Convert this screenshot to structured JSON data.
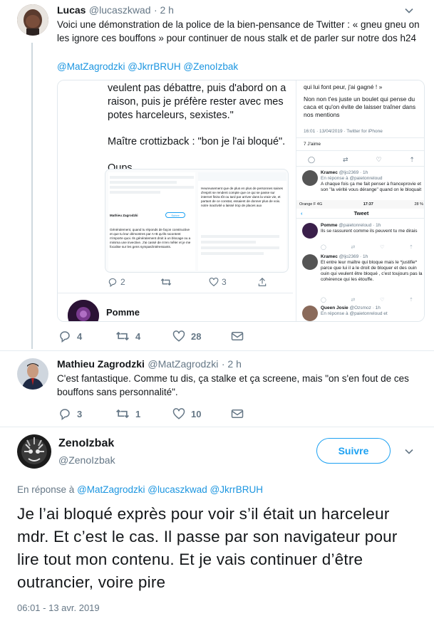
{
  "tweet1": {
    "name": "Lucas",
    "handle": "@lucaszkwad",
    "time": "· 2 h",
    "text": "Voici une démonstration de la police de la bien-pensance de Twitter : « gneu gneu on les ignore ces bouffons » pour continuer de nous stalk et de parler sur notre dos h24",
    "mentions": "@MatZagrodzki @JkrrBRUH @ZenoIzbak",
    "replies": "4",
    "retweets": "4",
    "likes": "28",
    "media": {
      "left_lines": [
        "veulent pas débattre, puis d'abord on a",
        "raison, puis je préfère rester avec mes",
        "potes harceleurs, sexistes.\"",
        "Maître crottizback : \"bon je l'ai bloqué\".",
        "Oups"
      ],
      "left_card_text": "Généralement, quand tu réponds de façon constructive et que tu leur démontres par A+B qu'ils racontent n'importe quoi. Ils généralement droit à un blocage ou a minima une invective. J'ai cassé de m'en mêler et je me focalise sur les gens sympas/intéressants.",
      "left_card_text2": "Heureusement que de plus en plus de personnes saines d'esprit se rendent compte que ce qui se passe sur internet finira tôt ou tard par arriver dans la vraie vie, et partant de ce constat, essaient de donner plus de voix. notre inactivité a laissé trop de places aux",
      "left_card_author": "Mathieu Zagrodzki",
      "left_card_btn": "Suivre",
      "inner_counts": [
        "2",
        "3"
      ],
      "bottom_name": "Pomme",
      "right_top_lines": [
        "qui lui font peur, j'ai gagné ! »",
        "Non non t'es juste un boulet qui pense du caca et qu'on évite de laisser traîner dans nos mentions"
      ],
      "right_meta": "16:01 · 13/04/2019 · Twitter for iPhone",
      "right_likes": "7 J'aime",
      "right_r1_name": "Kramec",
      "right_r1_handle": "@ljo2369 · 1h",
      "right_r1_reply": "En réponse à @paietonreloud",
      "right_r1_text": "A chaque fois ça me fait penser à franceprovie et son \"la vérité vous dérange\" quand on le bloquait",
      "status_carrier": "Orange F 4G",
      "status_time": "17:37",
      "status_battery": "28 %",
      "nav_title": "Tweet",
      "right_r2_name": "Pomme",
      "right_r2_handle": "@paietonreloud · 1h",
      "right_r2_text": "Ils se rassurent comme ils peuvent tu me dirais",
      "right_r3_name": "Kramec",
      "right_r3_handle": "@ljo2369 · 1h",
      "right_r3_text": "Et entre leur maître qui bloque mais le *justifie* parce que lui il a le droit de bloquer et des ouin ouin qui veulent être bloqué , c'est toujours pas la cohérence qui les étouffe.",
      "right_r4_name": "Queen Josie",
      "right_r4_handle": "@Ozsmoz · 1h",
      "right_r4_reply": "En réponse à @paietonreloud et"
    }
  },
  "tweet2": {
    "name": "Mathieu Zagrodzki",
    "handle": "@MatZagrodzki",
    "time": "· 2 h",
    "text": "C'est fantastique. Comme tu dis, ça stalke et ça screene, mais \"on s'en fout de ces bouffons sans personnalité\".",
    "replies": "3",
    "retweets": "1",
    "likes": "10"
  },
  "main": {
    "name": "ZenoIzbak",
    "handle": "@ZenoIzbak",
    "follow_label": "Suivre",
    "reply_prefix": "En réponse à",
    "reply_mentions": "@MatZagrodzki @lucaszkwad @JkrrBRUH",
    "text": "Je l’ai bloqué exprès pour voir s’il était un harceleur mdr. Et c’est le cas. Il passe par son navigateur pour lire tout mon contenu. Et je vais continuer d’être outrancier, voire pire",
    "timestamp": "06:01 - 13 avr. 2019"
  },
  "colors": {
    "accent": "#1da1f2",
    "mention": "#1b95e0",
    "muted": "#657786"
  }
}
